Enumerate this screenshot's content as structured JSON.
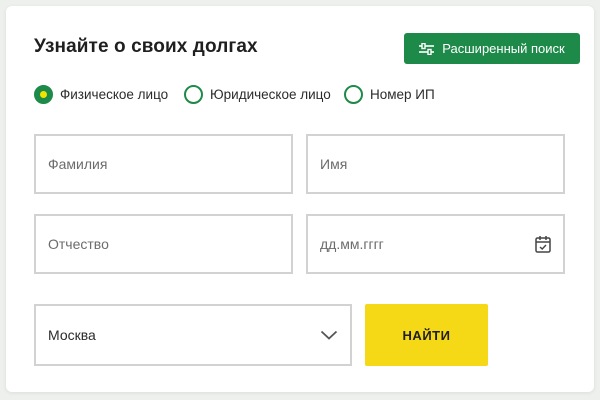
{
  "form": {
    "title": "Узнайте о своих долгах",
    "advanced_search_label": "Расширенный поиск",
    "advanced_search_icon": "sliders-icon",
    "radio_options": [
      {
        "label": "Физическое лицо",
        "checked": true
      },
      {
        "label": "Юридическое лицо",
        "checked": false
      },
      {
        "label": "Номер ИП",
        "checked": false
      }
    ],
    "fields": {
      "surname_placeholder": "Фамилия",
      "name_placeholder": "Имя",
      "patronymic_placeholder": "Отчество",
      "date_placeholder": "дд.мм.гггг",
      "date_icon": "calendar-icon"
    },
    "region_select": {
      "value": "Москва",
      "icon": "chevron-down-icon"
    },
    "submit_label": "НАЙТИ"
  },
  "colors": {
    "accent_green": "#1e8a4a",
    "submit_yellow": "#f5d816",
    "radio_dot_yellow": "#f3e400",
    "field_border": "#d2d2d2"
  }
}
